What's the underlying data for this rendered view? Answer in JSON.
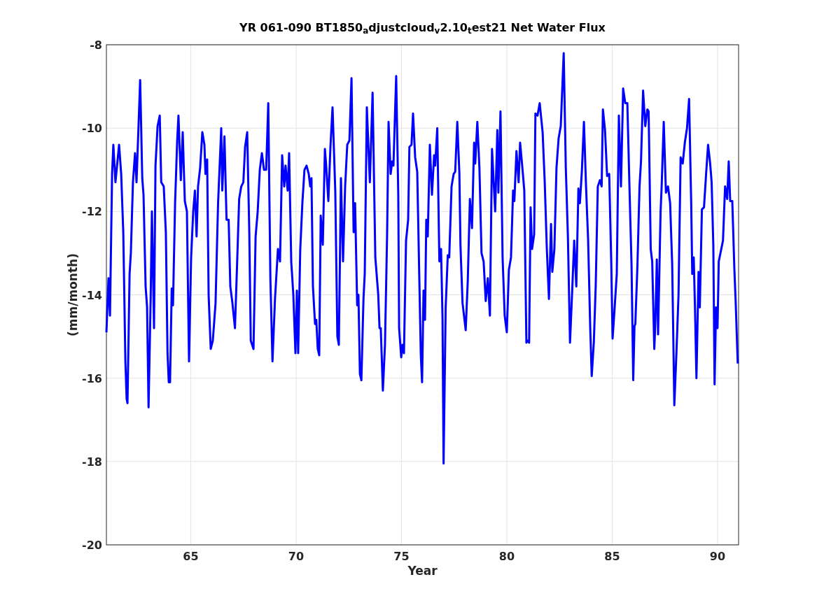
{
  "figure": {
    "chart_data": {
      "type": "line",
      "grid": true,
      "title": "YR 061-090 BT1850$_{a}$djustcloud$_{v}$2.10$_{t}$est21 Net Water Flux",
      "xlabel": "Year",
      "ylabel": "(mm/month)",
      "xlim": [
        61,
        91
      ],
      "ylim": [
        -20,
        -8
      ],
      "xticks": [
        65,
        70,
        75,
        80,
        85,
        90
      ],
      "yticks": [
        -20,
        -18,
        -16,
        -14,
        -12,
        -10,
        -8
      ],
      "x": [
        61.0,
        61.1,
        61.17,
        61.27,
        61.33,
        61.43,
        61.6,
        61.7,
        61.8,
        61.9,
        61.96,
        62.0,
        62.1,
        62.16,
        62.26,
        62.36,
        62.43,
        62.6,
        62.7,
        62.76,
        62.86,
        62.93,
        63.0,
        63.1,
        63.16,
        63.26,
        63.33,
        63.43,
        63.53,
        63.6,
        63.72,
        63.82,
        63.9,
        63.96,
        64.02,
        64.1,
        64.16,
        64.26,
        64.36,
        64.42,
        64.53,
        64.62,
        64.72,
        64.82,
        64.92,
        65.02,
        65.12,
        65.2,
        65.28,
        65.35,
        65.45,
        65.55,
        65.65,
        65.7,
        65.78,
        65.85,
        65.95,
        66.05,
        66.18,
        66.3,
        66.45,
        66.5,
        66.6,
        66.7,
        66.8,
        66.88,
        66.98,
        67.1,
        67.2,
        67.3,
        67.4,
        67.5,
        67.58,
        67.68,
        67.78,
        67.85,
        67.98,
        68.08,
        68.18,
        68.28,
        68.38,
        68.48,
        68.58,
        68.68,
        68.78,
        68.88,
        69.0,
        69.14,
        69.24,
        69.34,
        69.44,
        69.5,
        69.6,
        69.67,
        69.77,
        69.87,
        69.97,
        70.04,
        70.1,
        70.2,
        70.3,
        70.4,
        70.5,
        70.6,
        70.67,
        70.73,
        70.8,
        70.9,
        70.96,
        71.03,
        71.1,
        71.17,
        71.27,
        71.37,
        71.43,
        71.53,
        71.63,
        71.73,
        71.86,
        71.96,
        72.03,
        72.13,
        72.23,
        72.33,
        72.43,
        72.53,
        72.63,
        72.73,
        72.8,
        72.9,
        72.96,
        73.03,
        73.1,
        73.2,
        73.26,
        73.36,
        73.5,
        73.63,
        73.76,
        73.9,
        73.96,
        74.02,
        74.12,
        74.22,
        74.32,
        74.39,
        74.49,
        74.56,
        74.62,
        74.75,
        74.85,
        74.89,
        74.99,
        75.05,
        75.12,
        75.22,
        75.32,
        75.38,
        75.48,
        75.55,
        75.65,
        75.75,
        75.85,
        75.92,
        75.98,
        76.05,
        76.12,
        76.18,
        76.25,
        76.35,
        76.45,
        76.55,
        76.6,
        76.7,
        76.8,
        76.88,
        76.95,
        77.0,
        77.1,
        77.2,
        77.27,
        77.38,
        77.48,
        77.55,
        77.65,
        77.75,
        77.8,
        77.9,
        78.05,
        78.15,
        78.25,
        78.35,
        78.45,
        78.5,
        78.6,
        78.7,
        78.8,
        78.9,
        79.0,
        79.1,
        79.2,
        79.3,
        79.45,
        79.55,
        79.6,
        79.7,
        79.8,
        79.9,
        80.0,
        80.1,
        80.2,
        80.3,
        80.36,
        80.46,
        80.56,
        80.63,
        80.73,
        80.83,
        80.93,
        81.0,
        81.06,
        81.13,
        81.2,
        81.3,
        81.36,
        81.46,
        81.56,
        81.7,
        81.8,
        81.9,
        82.0,
        82.1,
        82.16,
        82.26,
        82.36,
        82.46,
        82.56,
        82.7,
        82.8,
        82.9,
        83.0,
        83.1,
        83.2,
        83.3,
        83.4,
        83.47,
        83.56,
        83.66,
        83.76,
        83.86,
        83.96,
        84.03,
        84.13,
        84.22,
        84.32,
        84.42,
        84.5,
        84.56,
        84.66,
        84.76,
        84.86,
        84.96,
        85.02,
        85.12,
        85.22,
        85.32,
        85.42,
        85.52,
        85.62,
        85.72,
        85.82,
        85.92,
        86.0,
        86.06,
        86.1,
        86.2,
        86.3,
        86.37,
        86.47,
        86.57,
        86.67,
        86.73,
        86.83,
        86.9,
        87.0,
        87.05,
        87.12,
        87.18,
        87.3,
        87.35,
        87.45,
        87.55,
        87.65,
        87.75,
        87.85,
        87.95,
        88.05,
        88.15,
        88.25,
        88.35,
        88.45,
        88.55,
        88.65,
        88.75,
        88.8,
        88.87,
        88.93,
        89.0,
        89.1,
        89.16,
        89.26,
        89.36,
        89.46,
        89.55,
        89.65,
        89.72,
        89.8,
        89.86,
        89.93,
        90.0,
        90.06,
        90.16,
        90.26,
        90.36,
        90.46,
        90.53,
        90.6,
        90.7,
        90.8,
        90.86,
        90.96
      ],
      "series": [
        {
          "color": "#0000ff",
          "values": [
            -14.9,
            -13.6,
            -14.5,
            -11.1,
            -10.4,
            -11.3,
            -10.4,
            -11.1,
            -12.5,
            -15.6,
            -16.5,
            -16.6,
            -13.5,
            -13.0,
            -11.3,
            -10.6,
            -11.3,
            -8.85,
            -11.2,
            -11.6,
            -13.8,
            -14.3,
            -16.7,
            -14.1,
            -12.0,
            -14.8,
            -10.9,
            -9.95,
            -9.7,
            -11.3,
            -11.4,
            -12.5,
            -15.4,
            -16.1,
            -16.1,
            -13.85,
            -14.25,
            -11.8,
            -10.3,
            -9.7,
            -11.25,
            -10.1,
            -11.75,
            -12.0,
            -15.6,
            -13.1,
            -12.0,
            -11.5,
            -12.6,
            -11.4,
            -10.95,
            -10.1,
            -10.4,
            -11.1,
            -10.75,
            -14.0,
            -15.3,
            -15.1,
            -14.2,
            -11.8,
            -10.0,
            -11.5,
            -10.2,
            -12.2,
            -12.2,
            -13.8,
            -14.2,
            -14.8,
            -13.3,
            -11.7,
            -11.4,
            -11.3,
            -10.45,
            -10.1,
            -12.5,
            -15.1,
            -15.3,
            -12.6,
            -12.0,
            -11.0,
            -10.6,
            -11.0,
            -11.0,
            -9.4,
            -13.6,
            -15.6,
            -14.1,
            -12.9,
            -13.2,
            -10.65,
            -11.4,
            -10.9,
            -11.5,
            -10.6,
            -13.2,
            -14.0,
            -15.4,
            -13.9,
            -15.4,
            -12.9,
            -11.8,
            -11.0,
            -10.9,
            -11.1,
            -11.4,
            -11.2,
            -13.8,
            -14.7,
            -14.6,
            -15.3,
            -15.45,
            -12.1,
            -12.8,
            -10.5,
            -10.9,
            -11.75,
            -10.45,
            -9.5,
            -11.5,
            -15.0,
            -15.2,
            -11.2,
            -13.2,
            -11.4,
            -10.4,
            -10.3,
            -8.8,
            -12.5,
            -11.8,
            -14.25,
            -14.0,
            -15.9,
            -16.05,
            -14.1,
            -13.5,
            -9.5,
            -11.3,
            -9.15,
            -13.1,
            -14.0,
            -14.8,
            -14.8,
            -16.3,
            -15.2,
            -12.6,
            -9.85,
            -11.1,
            -10.8,
            -10.9,
            -8.75,
            -11.6,
            -14.8,
            -15.5,
            -15.2,
            -15.4,
            -12.7,
            -12.2,
            -10.45,
            -10.4,
            -9.65,
            -10.7,
            -11.05,
            -13.65,
            -15.45,
            -16.1,
            -13.9,
            -14.6,
            -12.2,
            -12.6,
            -10.4,
            -11.6,
            -10.65,
            -10.9,
            -10.0,
            -13.2,
            -12.9,
            -14.55,
            -18.05,
            -14.3,
            -13.05,
            -13.1,
            -11.4,
            -11.1,
            -11.05,
            -9.85,
            -11.1,
            -12.8,
            -14.2,
            -14.85,
            -13.65,
            -11.7,
            -12.4,
            -10.35,
            -10.85,
            -9.85,
            -10.95,
            -13.0,
            -13.2,
            -14.15,
            -13.6,
            -14.5,
            -10.5,
            -12.0,
            -10.05,
            -11.55,
            -9.6,
            -13.1,
            -14.5,
            -14.9,
            -13.4,
            -13.1,
            -11.5,
            -11.75,
            -10.55,
            -11.3,
            -10.35,
            -10.9,
            -11.5,
            -15.15,
            -15.1,
            -15.15,
            -11.9,
            -12.9,
            -12.55,
            -9.65,
            -9.7,
            -9.4,
            -10.1,
            -11.3,
            -12.9,
            -14.1,
            -12.3,
            -13.45,
            -12.9,
            -10.95,
            -10.25,
            -9.95,
            -8.2,
            -10.95,
            -12.6,
            -15.15,
            -13.95,
            -12.7,
            -13.8,
            -11.45,
            -11.8,
            -11.05,
            -9.85,
            -11.4,
            -12.7,
            -14.8,
            -15.95,
            -15.15,
            -13.8,
            -11.4,
            -11.25,
            -11.4,
            -9.55,
            -10.05,
            -11.15,
            -11.1,
            -13.3,
            -15.05,
            -14.3,
            -13.5,
            -9.7,
            -11.4,
            -9.05,
            -9.4,
            -9.4,
            -11.4,
            -13.3,
            -16.05,
            -14.75,
            -14.7,
            -13.3,
            -11.4,
            -10.8,
            -9.1,
            -9.95,
            -9.55,
            -9.6,
            -12.9,
            -13.2,
            -15.3,
            -14.65,
            -13.15,
            -14.95,
            -12.0,
            -11.4,
            -9.85,
            -11.55,
            -11.4,
            -11.8,
            -13.3,
            -16.65,
            -15.4,
            -14.0,
            -10.7,
            -10.85,
            -10.35,
            -10.0,
            -9.3,
            -11.8,
            -13.5,
            -13.1,
            -14.3,
            -16.0,
            -13.45,
            -14.3,
            -11.95,
            -11.9,
            -11.1,
            -10.4,
            -10.85,
            -11.3,
            -12.8,
            -16.15,
            -14.3,
            -14.8,
            -13.2,
            -12.95,
            -12.7,
            -11.4,
            -11.7,
            -10.8,
            -11.75,
            -11.75,
            -13.4,
            -14.15,
            -15.65
          ]
        }
      ]
    }
  }
}
